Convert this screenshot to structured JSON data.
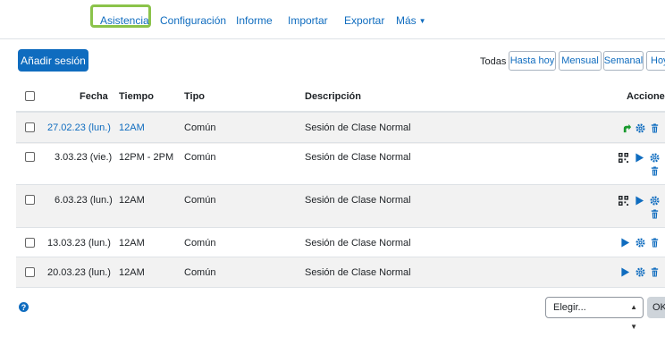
{
  "tabs": [
    "Asistencia",
    "Configuración",
    "Informe",
    "Importar",
    "Exportar",
    "Más"
  ],
  "add_session_label": "Añadir sesión",
  "filter": {
    "label": "Todas",
    "buttons": [
      "Hasta hoy",
      "Mensual",
      "Semanal",
      "Hoy"
    ]
  },
  "table": {
    "headers": {
      "date": "Fecha",
      "time": "Tiempo",
      "type": "Tipo",
      "description": "Descripción",
      "actions": "Acciones"
    },
    "rows": [
      {
        "date": "27.02.23 (lun.)",
        "time": "12AM",
        "type": "Común",
        "description": "Sesión de Clase Normal"
      },
      {
        "date": "3.03.23 (vie.)",
        "time": "12PM - 2PM",
        "type": "Común",
        "description": "Sesión de Clase Normal"
      },
      {
        "date": "6.03.23 (lun.)",
        "time": "12AM",
        "type": "Común",
        "description": "Sesión de Clase Normal"
      },
      {
        "date": "13.03.23 (lun.)",
        "time": "12AM",
        "type": "Común",
        "description": "Sesión de Clase Normal"
      },
      {
        "date": "20.03.23 (lun.)",
        "time": "12AM",
        "type": "Común",
        "description": "Sesión de Clase Normal"
      }
    ]
  },
  "footer": {
    "help_glyph": "?",
    "select_value": "Elegir...",
    "ok_label": "OK"
  },
  "colors": {
    "accent": "#0f6cbf",
    "active_tab_outline": "#8bc34a",
    "take_attendance_green": "#1a9a2f"
  }
}
